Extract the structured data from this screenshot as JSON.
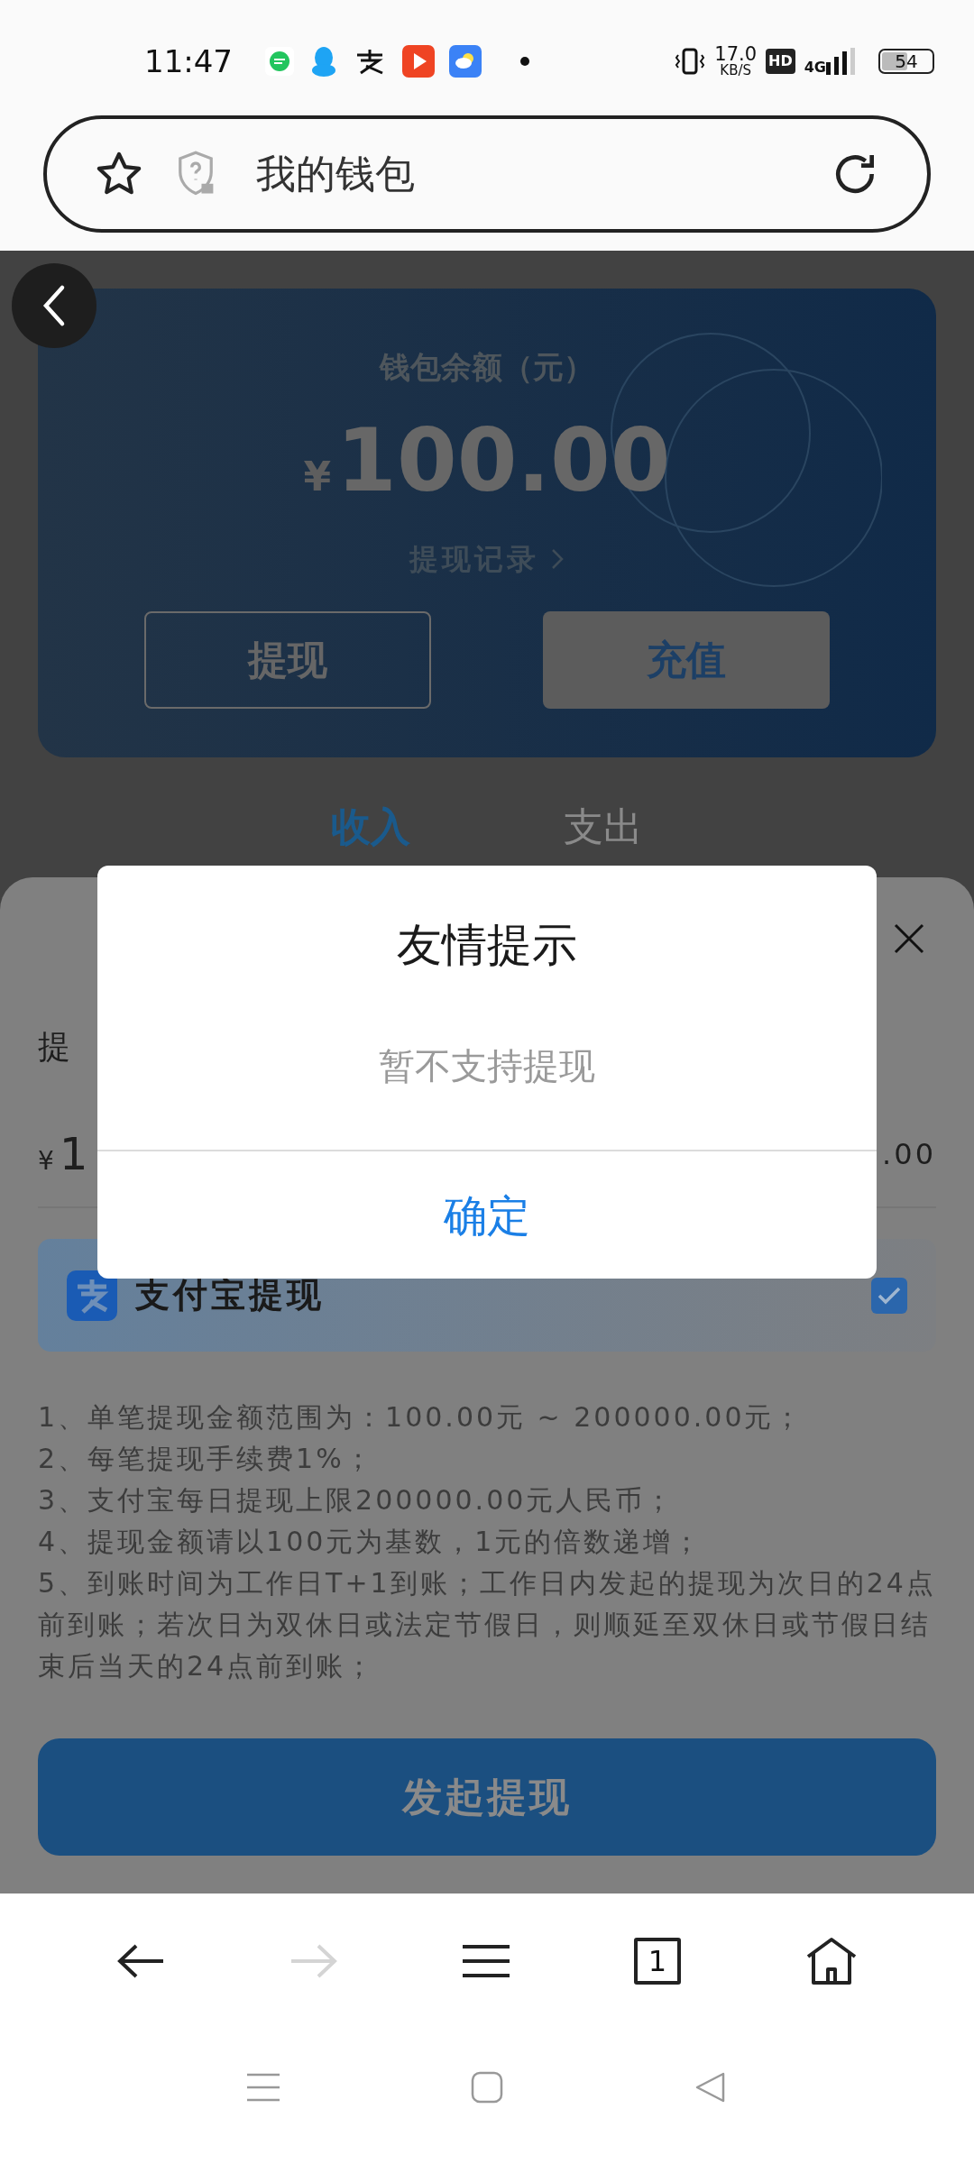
{
  "status_bar": {
    "time": "11:47",
    "net_speed": "17.0",
    "net_unit": "KB/S",
    "hd": "HD",
    "network": "4G",
    "battery": "54"
  },
  "address_bar": {
    "title": "我的钱包"
  },
  "wallet_card": {
    "label": "钱包余额（元）",
    "currency": "¥",
    "balance": "100.00",
    "record_link": "提现记录",
    "buttons": [
      {
        "label": "提现",
        "kind": "outline"
      },
      {
        "label": "充值",
        "kind": "filled"
      }
    ]
  },
  "tabs": [
    {
      "label": "收入",
      "selected": true
    },
    {
      "label": "支出",
      "selected": false
    }
  ],
  "withdraw_sheet": {
    "label": "提",
    "amount": "¥1",
    "amount_right": ".00",
    "option": {
      "label": "支付宝提现",
      "checked": true
    },
    "notes": [
      "1、单笔提现金额范围为：100.00元 ~ 200000.00元；",
      "2、每笔提现手续费1%；",
      "3、支付宝每日提现上限200000.00元人民币；",
      "4、提现金额请以100元为基数，1元的倍数递增；",
      "5、到账时间为工作日T+1到账；工作日内发起的提现为次日的24点前到账；若次日为双休日或法定节假日，则顺延至双休日或节假日结束后当天的24点前到账；"
    ],
    "submit": "发起提现"
  },
  "dialog": {
    "title": "友情提示",
    "message": "暂不支持提现",
    "confirm": "确定"
  },
  "browser_nav": {
    "forward_disabled": true,
    "tab_count": "1"
  }
}
